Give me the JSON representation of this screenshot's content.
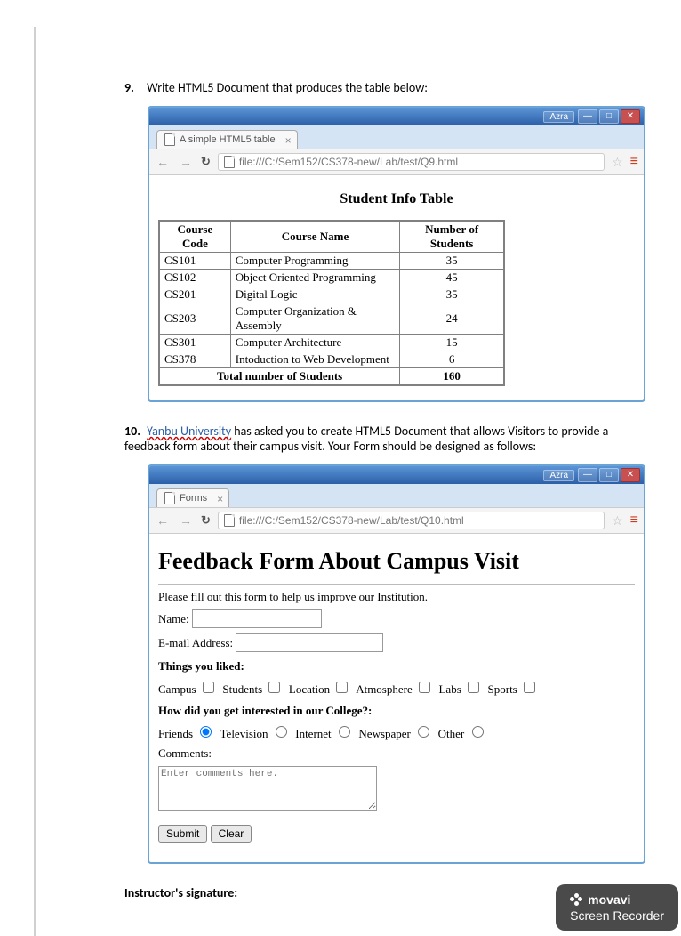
{
  "q9": {
    "number": "9.",
    "text": "Write HTML5 Document that produces the table below:",
    "browser": {
      "azra": "Azra",
      "tab_title": "A simple HTML5 table",
      "url": "file:///C:/Sem152/CS378-new/Lab/test/Q9.html"
    },
    "table": {
      "title": "Student Info Table",
      "headers": [
        "Course Code",
        "Course Name",
        "Number of Students"
      ],
      "rows": [
        [
          "CS101",
          "Computer Programming",
          "35"
        ],
        [
          "CS102",
          "Object Oriented Programming",
          "45"
        ],
        [
          "CS201",
          "Digital Logic",
          "35"
        ],
        [
          "CS203",
          "Computer Organization & Assembly",
          "24"
        ],
        [
          "CS301",
          "Computer Architecture",
          "15"
        ],
        [
          "CS378",
          "Intoduction to Web Development",
          "6"
        ]
      ],
      "total_label": "Total number of Students",
      "total_value": "160"
    }
  },
  "q10": {
    "number": "10.",
    "link_text": "Yanbu  University",
    "text_after": " has asked you to create HTML5 Document that allows Visitors to provide a feedback form about their campus visit. Your Form should be designed as follows:",
    "browser": {
      "azra": "Azra",
      "tab_title": "Forms",
      "url": "file:///C:/Sem152/CS378-new/Lab/test/Q10.html"
    },
    "form": {
      "heading": "Feedback Form About Campus Visit",
      "intro": "Please fill out this form to help us improve our Institution.",
      "name_label": "Name:",
      "email_label": "E-mail Address:",
      "liked_title": "Things you liked:",
      "liked_options": [
        "Campus",
        "Students",
        "Location",
        "Atmosphere",
        "Labs",
        "Sports"
      ],
      "interest_title": "How did you get interested in our College?:",
      "interest_options": [
        "Friends",
        "Television",
        "Internet",
        "Newspaper",
        "Other"
      ],
      "comments_label": "Comments:",
      "comments_placeholder": "Enter comments here.",
      "submit_label": "Submit",
      "clear_label": "Clear"
    }
  },
  "footer": {
    "signature_label": "Instructor's signature:"
  },
  "watermark": {
    "brand": "movavi",
    "product": "Screen Recorder"
  }
}
